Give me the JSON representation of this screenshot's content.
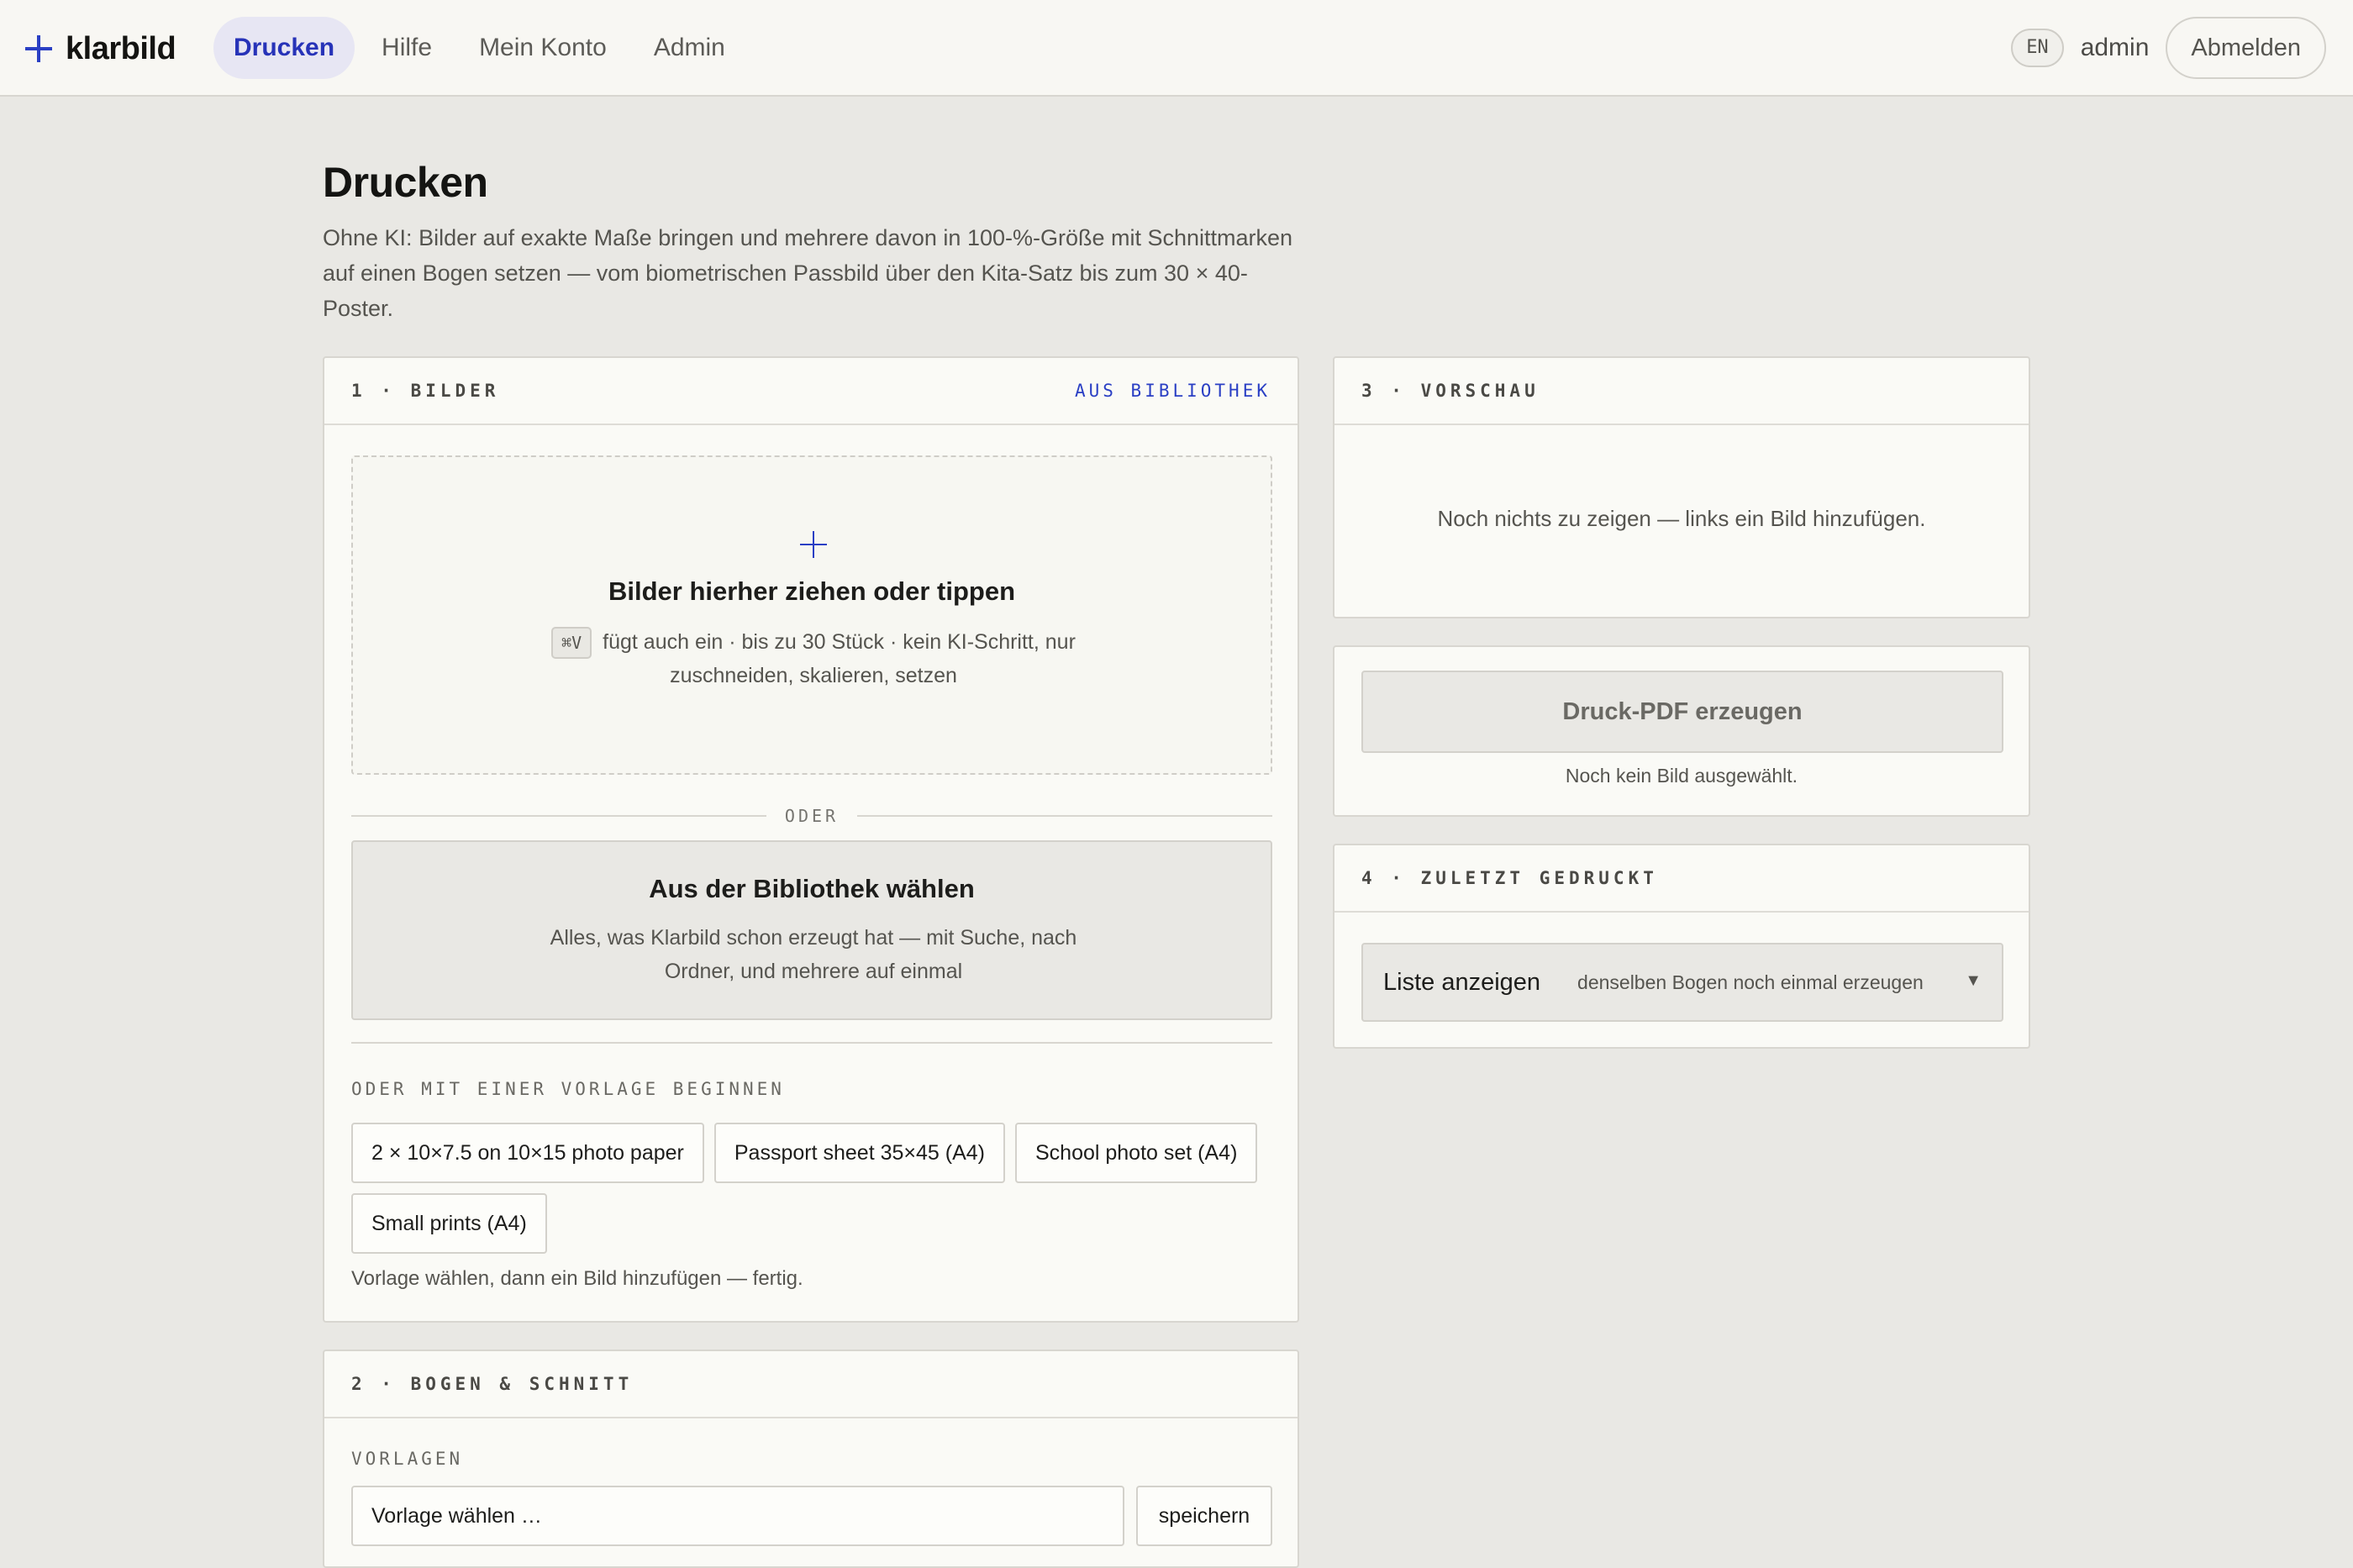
{
  "app": {
    "name": "klarbild"
  },
  "nav": {
    "items": [
      {
        "label": "Drucken",
        "active": true
      },
      {
        "label": "Hilfe",
        "active": false
      },
      {
        "label": "Mein Konto",
        "active": false
      },
      {
        "label": "Admin",
        "active": false
      }
    ]
  },
  "header": {
    "lang": "EN",
    "user": "admin",
    "logout": "Abmelden"
  },
  "page": {
    "title": "Drucken",
    "description": "Ohne KI: Bilder auf exakte Maße bringen und mehrere davon in 100-%-Größe mit Schnittmarken auf einen Bogen setzen — vom biometrischen Passbild über den Kita-Satz bis zum 30 × 40-Poster."
  },
  "images_card": {
    "title": "1 · BILDER",
    "library_link": "AUS BIBLIOTHEK",
    "dropzone": {
      "title": "Bilder hierher ziehen oder tippen",
      "shortcut": "⌘V",
      "subtitle": "fügt auch ein · bis zu 30 Stück · kein KI-Schritt, nur zuschneiden, skalieren, setzen"
    },
    "or_label": "ODER",
    "library": {
      "title": "Aus der Bibliothek wählen",
      "subtitle": "Alles, was Klarbild schon erzeugt hat — mit Suche, nach Ordner, und mehrere auf einmal"
    },
    "templates_label": "ODER MIT EINER VORLAGE BEGINNEN",
    "templates": [
      "2 × 10×7.5 on 10×15 photo paper",
      "Passport sheet 35×45 (A4)",
      "School photo set (A4)",
      "Small prints (A4)"
    ],
    "templates_hint": "Vorlage wählen, dann ein Bild hinzufügen — fertig."
  },
  "sheet_card": {
    "title": "2 · BOGEN & SCHNITT",
    "templates_label": "VORLAGEN",
    "select_placeholder": "Vorlage wählen …",
    "save_label": "speichern"
  },
  "preview_card": {
    "title": "3 · VORSCHAU",
    "empty": "Noch nichts zu zeigen — links ein Bild hinzufügen."
  },
  "pdf_card": {
    "button": "Druck-PDF erzeugen",
    "hint": "Noch kein Bild ausgewählt."
  },
  "recent_card": {
    "title": "4 · ZULETZT GEDRUCKT",
    "toggle": "Liste anzeigen",
    "subtitle": "denselben Bogen noch einmal erzeugen",
    "caret": "▼"
  },
  "colors": {
    "accent": "#2a3fc4",
    "page_bg": "#e9e8e4",
    "card_bg": "#fafaf6"
  }
}
